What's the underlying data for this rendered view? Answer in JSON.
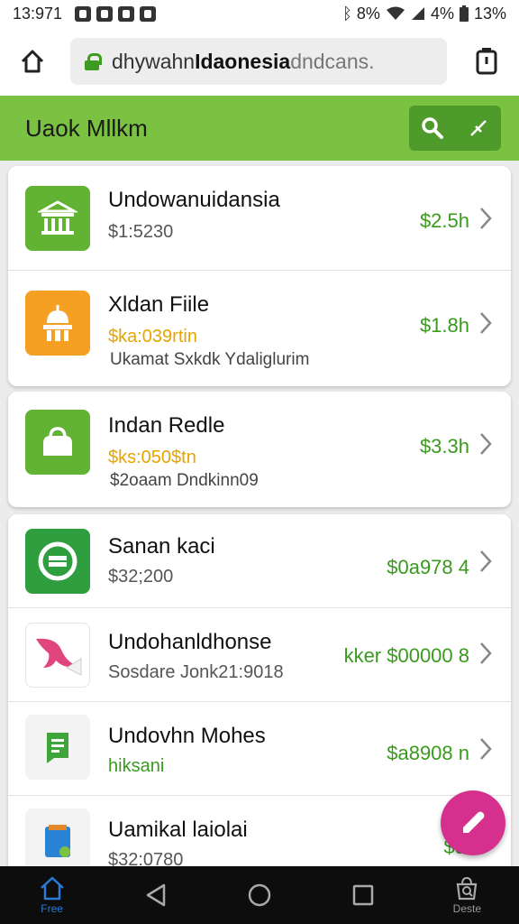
{
  "status_bar": {
    "time": "13:971",
    "indicators": "ᛒ 8% ",
    "battery_text": "4%",
    "extra": "13%"
  },
  "browser": {
    "url_domain": "dhywahn",
    "url_bold": "Idaonesia",
    "url_rest": " dndcans."
  },
  "app": {
    "title": "Uaok Mllkm"
  },
  "cards": [
    {
      "rows": [
        {
          "name": "Undowanuidansia",
          "sub1": "$1:5230",
          "sub2": "",
          "price": "$2.5h",
          "thumb_color": "#62b234",
          "icon": "market-icon"
        },
        {
          "name": "Xldan Fiile",
          "sub1": "$ka:039rtin",
          "sub2": "Ukamat Sxkdk Ydaliglurim",
          "price": "$1.8h",
          "thumb_color": "#f5a023",
          "icon": "temple-icon"
        }
      ]
    },
    {
      "rows": [
        {
          "name": "Indan Redle",
          "sub1": "$ks:050$tn",
          "sub2": "$2oaam Dndkinn09",
          "price": "$3.3h",
          "thumb_color": "#62b234",
          "icon": "bag-icon"
        }
      ]
    },
    {
      "rows": [
        {
          "name": "Sanan kaci",
          "sub1": "$32;200",
          "sub2": "",
          "price": "$0a978 4",
          "thumb_color": "#2e9e3e",
          "icon": "circle-bar-icon"
        },
        {
          "name": "Undohanldhonse",
          "sub1": "Sosdare Jonk21:9018",
          "sub2": "",
          "price": "kker $00000 8",
          "thumb_color": "#ffffff",
          "icon": "dolphin-icon"
        },
        {
          "name": "Undovhn Mohes",
          "sub1": "hiksani",
          "sub2": "",
          "price": "$a8908 n",
          "thumb_color": "#f3f3f3",
          "icon": "document-icon"
        },
        {
          "name": "Uamikal laiolai",
          "sub1": "$32:0780",
          "sub2": "",
          "price": "$5",
          "thumb_color": "#f3f3f3",
          "icon": "card-icon"
        }
      ]
    }
  ],
  "nav": {
    "home_label": "Free",
    "search_label": "Deste"
  }
}
